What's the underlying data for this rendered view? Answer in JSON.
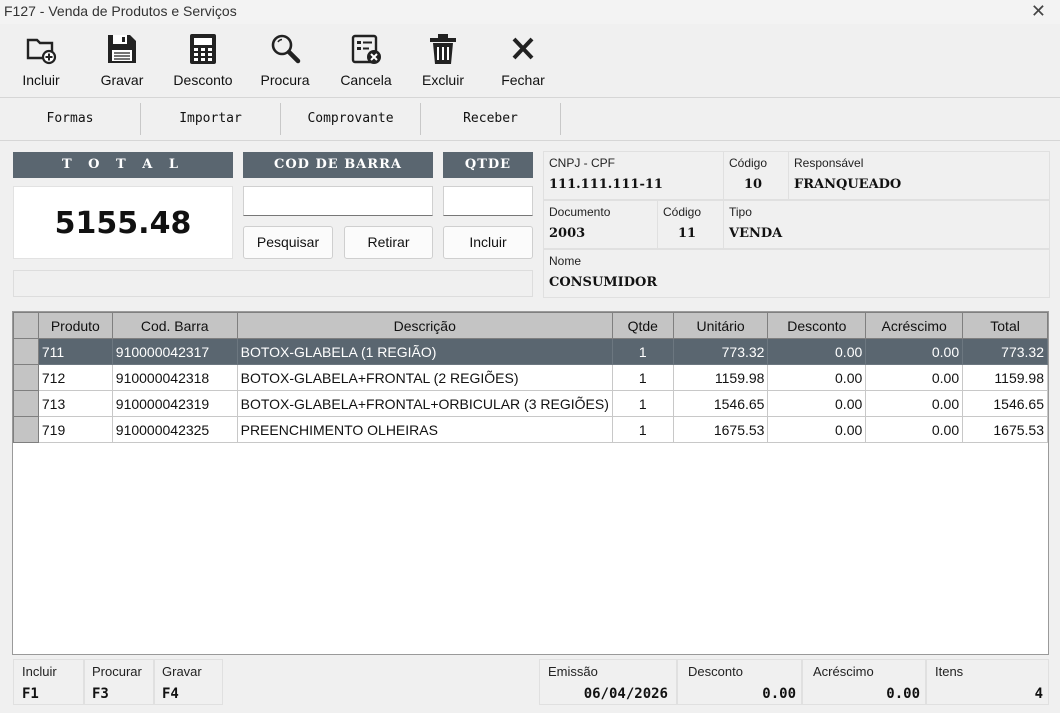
{
  "window": {
    "title": "F127 - Venda de Produtos e Serviços"
  },
  "toolbar": [
    {
      "label": "Incluir",
      "icon": "folder-add-icon"
    },
    {
      "label": "Gravar",
      "icon": "floppy-disk-icon"
    },
    {
      "label": "Desconto",
      "icon": "calculator-icon"
    },
    {
      "label": "Procura",
      "icon": "search-icon"
    },
    {
      "label": "Cancela",
      "icon": "cancel-document-icon"
    },
    {
      "label": "Excluir",
      "icon": "trash-icon"
    },
    {
      "label": "Fechar",
      "icon": "close-x-icon"
    }
  ],
  "subbar": [
    "Formas",
    "Importar",
    "Comprovante",
    "Receber"
  ],
  "total": {
    "header": "T O T A L",
    "value": "5155.48"
  },
  "barcode": {
    "header": "COD DE BARRA",
    "value": "",
    "search_label": "Pesquisar",
    "remove_label": "Retirar"
  },
  "qty": {
    "header": "QTDE",
    "value": "",
    "include_label": "Incluir"
  },
  "client": {
    "cnpj_label": "CNPJ - CPF",
    "cnpj": "111.111.111-11",
    "code_label": "Código",
    "code": "10",
    "resp_label": "Responsável",
    "resp": "FRANQUEADO",
    "doc_label": "Documento",
    "doc": "2003",
    "doc_code_label": "Código",
    "doc_code": "11",
    "type_label": "Tipo",
    "type": "VENDA",
    "name_label": "Nome",
    "name": "CONSUMIDOR"
  },
  "grid": {
    "columns": [
      "Produto",
      "Cod. Barra",
      "Descrição",
      "Qtde",
      "Unitário",
      "Desconto",
      "Acréscimo",
      "Total"
    ],
    "rows": [
      [
        "711",
        "910000042317",
        "BOTOX-GLABELA (1 REGIÃO)",
        "1",
        "773.32",
        "0.00",
        "0.00",
        "773.32"
      ],
      [
        "712",
        "910000042318",
        "BOTOX-GLABELA+FRONTAL (2 REGIÕES)",
        "1",
        "1159.98",
        "0.00",
        "0.00",
        "1159.98"
      ],
      [
        "713",
        "910000042319",
        "BOTOX-GLABELA+FRONTAL+ORBICULAR (3 REGIÕES)",
        "1",
        "1546.65",
        "0.00",
        "0.00",
        "1546.65"
      ],
      [
        "719",
        "910000042325",
        "PREENCHIMENTO OLHEIRAS",
        "1",
        "1675.53",
        "0.00",
        "0.00",
        "1675.53"
      ]
    ],
    "selected_row": 0
  },
  "footer": {
    "shortcuts": [
      {
        "label": "Incluir",
        "key": "F1"
      },
      {
        "label": "Procurar",
        "key": "F3"
      },
      {
        "label": "Gravar",
        "key": "F4"
      }
    ],
    "emissao_label": "Emissão",
    "emissao": "06/04/2026",
    "desconto_label": "Desconto",
    "desconto": "0.00",
    "acrescimo_label": "Acréscimo",
    "acrescimo": "0.00",
    "itens_label": "Itens",
    "itens": "4"
  },
  "colors": {
    "header_bg": "#5a6670",
    "grid_header": "#c4c4c4",
    "window_bg": "#f0f0f0"
  }
}
